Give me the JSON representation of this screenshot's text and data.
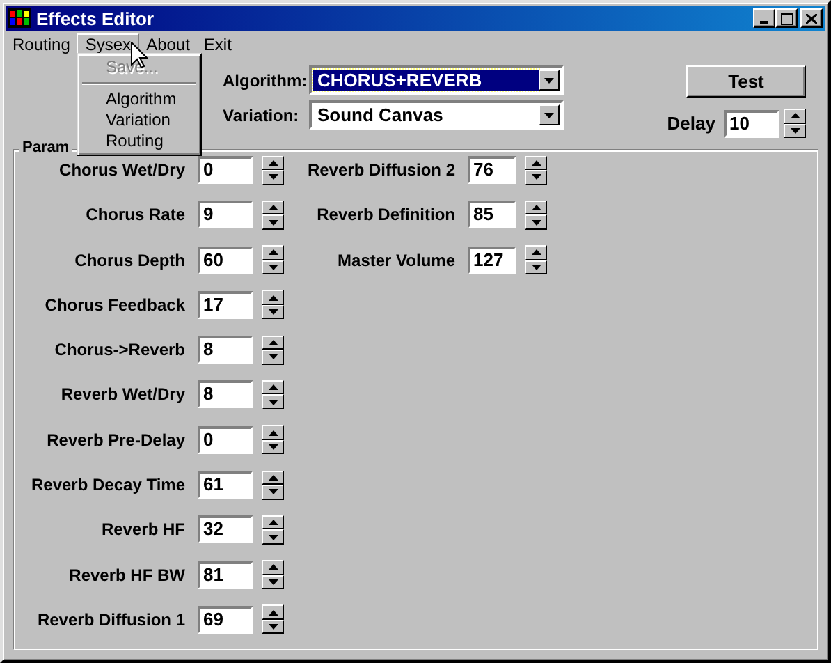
{
  "window": {
    "title": "Effects Editor"
  },
  "menu_bar": [
    {
      "label": "Routing",
      "selected": false
    },
    {
      "label": "Sysex",
      "selected": true
    },
    {
      "label": "About",
      "selected": false
    },
    {
      "label": "Exit",
      "selected": false
    }
  ],
  "open_menu": {
    "items": [
      {
        "kind": "item",
        "label": "Save...",
        "disabled": true
      },
      {
        "kind": "separator"
      },
      {
        "kind": "item",
        "label": "Algorithm",
        "disabled": false
      },
      {
        "kind": "item",
        "label": "Variation",
        "disabled": false
      },
      {
        "kind": "item",
        "label": "Routing",
        "disabled": false
      }
    ]
  },
  "algorithm": {
    "label": "Algorithm:",
    "value": "CHORUS+REVERB",
    "focused": true
  },
  "variation": {
    "label": "Variation:",
    "value": "Sound Canvas",
    "focused": false
  },
  "test_button": {
    "label": "Test"
  },
  "delay": {
    "label": "Delay",
    "value": "10"
  },
  "parameters": {
    "title": "Param",
    "columns": [
      [
        {
          "label": "Chorus Wet/Dry",
          "value": "0"
        },
        {
          "label": "Chorus Rate",
          "value": "9"
        },
        {
          "label": "Chorus Depth",
          "value": "60"
        },
        {
          "label": "Chorus Feedback",
          "value": "17"
        },
        {
          "label": "Chorus->Reverb",
          "value": "8"
        },
        {
          "label": "Reverb Wet/Dry",
          "value": "8"
        },
        {
          "label": "Reverb Pre-Delay",
          "value": "0"
        },
        {
          "label": "Reverb Decay Time",
          "value": "61"
        },
        {
          "label": "Reverb HF",
          "value": "32"
        },
        {
          "label": "Reverb HF BW",
          "value": "81"
        },
        {
          "label": "Reverb Diffusion 1",
          "value": "69"
        }
      ],
      [
        {
          "label": "Reverb Diffusion 2",
          "value": "76"
        },
        {
          "label": "Reverb Definition",
          "value": "85"
        },
        {
          "label": "Master Volume",
          "value": "127"
        }
      ]
    ]
  }
}
